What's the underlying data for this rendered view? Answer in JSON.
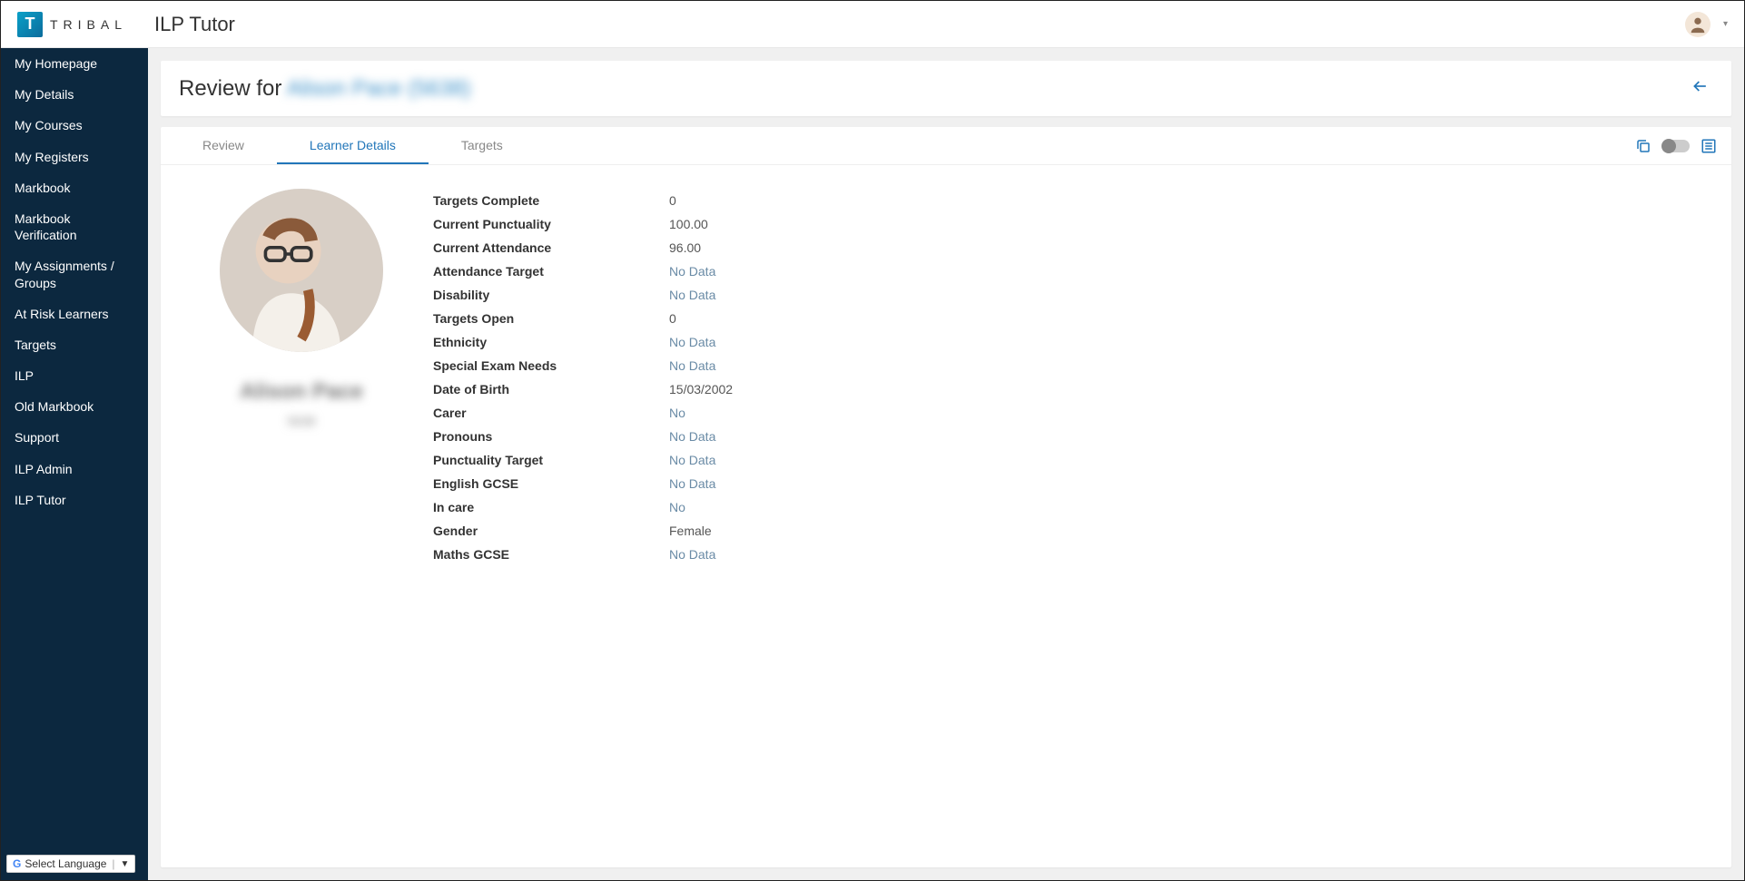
{
  "brand": {
    "mark": "T",
    "text": "TRIBAL"
  },
  "app_title": "ILP Tutor",
  "sidebar": {
    "items": [
      "My Homepage",
      "My Details",
      "My Courses",
      "My Registers",
      "Markbook",
      "Markbook Verification",
      "My Assignments / Groups",
      "At Risk Learners",
      "Targets",
      "ILP",
      "Old Markbook",
      "Support",
      "ILP Admin",
      "ILP Tutor"
    ]
  },
  "language_label": "Select Language",
  "page": {
    "title_prefix": "Review for ",
    "title_name_blurred": "Alison Pace (5638)"
  },
  "tabs": [
    {
      "label": "Review",
      "active": false
    },
    {
      "label": "Learner Details",
      "active": true
    },
    {
      "label": "Targets",
      "active": false
    }
  ],
  "learner": {
    "name_blurred": "Alison Pace",
    "code_blurred": "5638",
    "details": [
      {
        "label": "Targets Complete",
        "value": "0"
      },
      {
        "label": "Current Punctuality",
        "value": "100.00"
      },
      {
        "label": "Current Attendance",
        "value": "96.00"
      },
      {
        "label": "Attendance Target",
        "value": "No Data",
        "muted": true
      },
      {
        "label": "Disability",
        "value": "No Data",
        "muted": true
      },
      {
        "label": "Targets Open",
        "value": "0"
      },
      {
        "label": "Ethnicity",
        "value": "No Data",
        "muted": true
      },
      {
        "label": "Special Exam Needs",
        "value": "No Data",
        "muted": true
      },
      {
        "label": "Date of Birth",
        "value": "15/03/2002"
      },
      {
        "label": "Carer",
        "value": "No",
        "muted": true
      },
      {
        "label": "Pronouns",
        "value": "No Data",
        "muted": true
      },
      {
        "label": "Punctuality Target",
        "value": "No Data",
        "muted": true
      },
      {
        "label": "English GCSE",
        "value": "No Data",
        "muted": true
      },
      {
        "label": "In care",
        "value": "No",
        "muted": true
      },
      {
        "label": "Gender",
        "value": "Female"
      },
      {
        "label": "Maths GCSE",
        "value": "No Data",
        "muted": true
      }
    ]
  }
}
